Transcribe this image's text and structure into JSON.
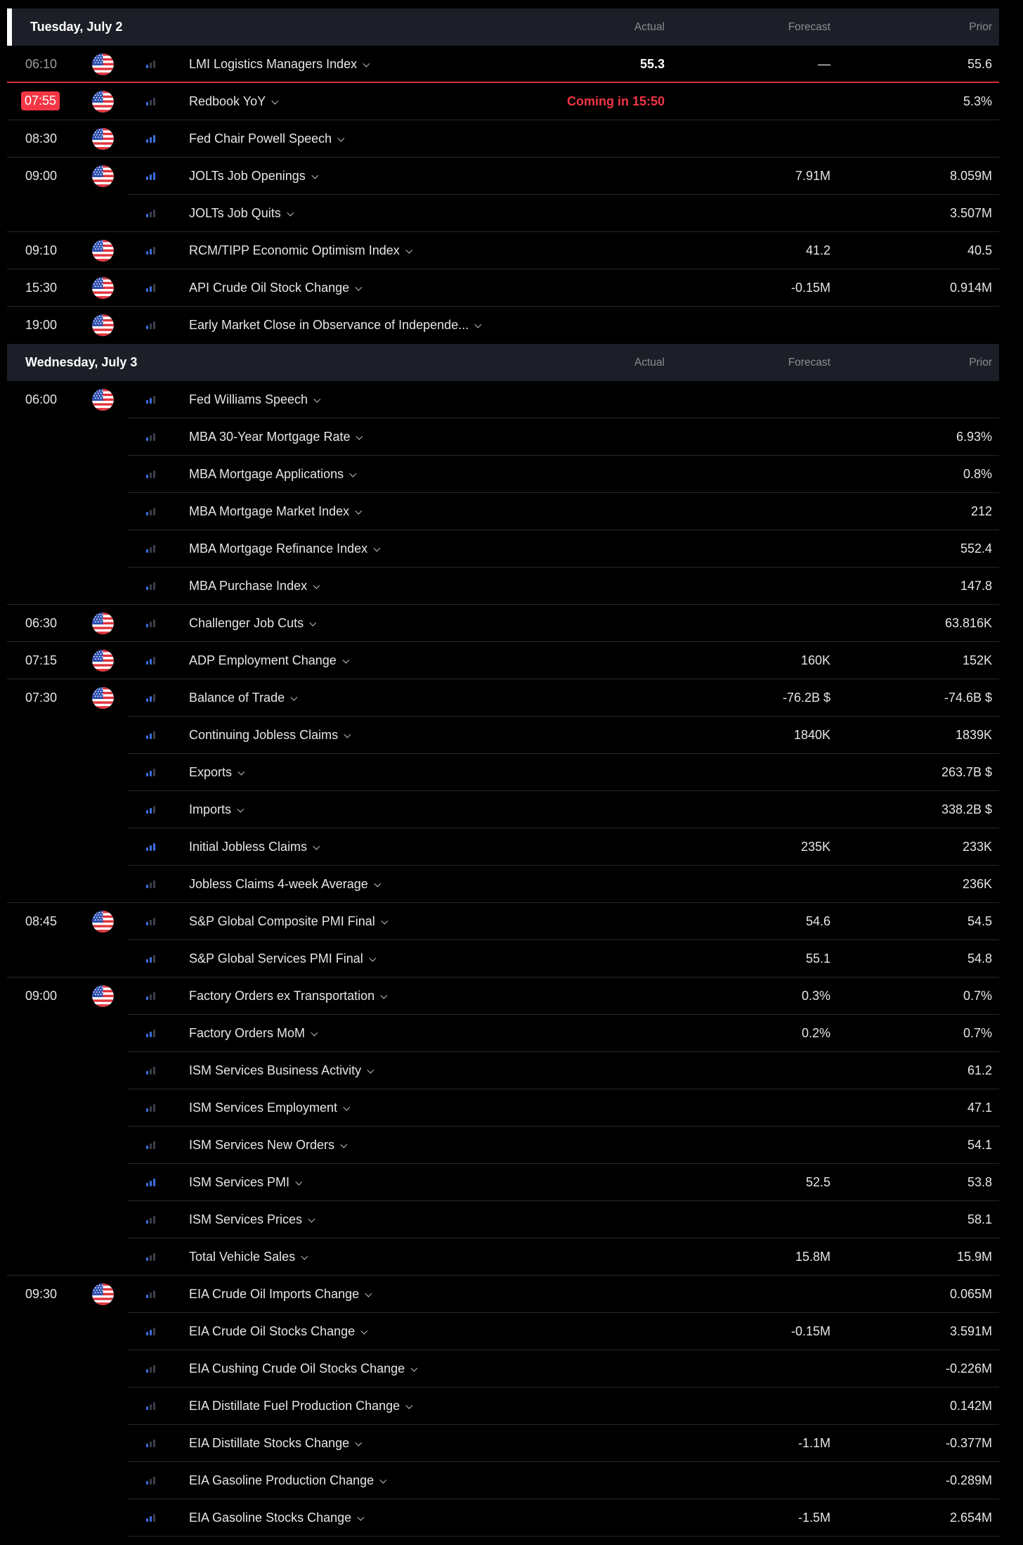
{
  "columns": {
    "actual": "Actual",
    "forecast": "Forecast",
    "prior": "Prior"
  },
  "colors": {
    "background": "#000000",
    "header_bg": "#1c1f27",
    "highlight": "#f23645",
    "bar_on": "#3b6fe0"
  },
  "days": [
    {
      "title": "Tuesday, July 2",
      "events": [
        {
          "time": "06:10",
          "time_style": "dim",
          "flag": true,
          "importance": 1,
          "name": "LMI Logistics Managers Index",
          "actual": "55.3",
          "forecast": "—",
          "prior": "55.6",
          "sep": "red"
        },
        {
          "time": "07:55",
          "time_style": "badge",
          "flag": true,
          "importance": 1,
          "name": "Redbook YoY",
          "actual": "Coming in 15:50",
          "actual_style": "coming",
          "forecast": "",
          "prior": "5.3%",
          "sep": "full"
        },
        {
          "time": "08:30",
          "flag": true,
          "importance": 3,
          "name": "Fed Chair Powell Speech",
          "actual": "",
          "forecast": "",
          "prior": "",
          "sep": "full"
        },
        {
          "time": "09:00",
          "flag": true,
          "importance": 3,
          "name": "JOLTs Job Openings",
          "actual": "",
          "forecast": "7.91M",
          "prior": "8.059M",
          "sep": "indent"
        },
        {
          "time": "",
          "flag": false,
          "importance": 1,
          "name": "JOLTs Job Quits",
          "actual": "",
          "forecast": "",
          "prior": "3.507M",
          "sep": "full"
        },
        {
          "time": "09:10",
          "flag": true,
          "importance": 2,
          "name": "RCM/TIPP Economic Optimism Index",
          "actual": "",
          "forecast": "41.2",
          "prior": "40.5",
          "sep": "full"
        },
        {
          "time": "15:30",
          "flag": true,
          "importance": 2,
          "name": "API Crude Oil Stock Change",
          "actual": "",
          "forecast": "-0.15M",
          "prior": "0.914M",
          "sep": "full"
        },
        {
          "time": "19:00",
          "flag": true,
          "importance": 1,
          "name": "Early Market Close in Observance of Independe...",
          "actual": "",
          "forecast": "",
          "prior": "",
          "sep": "none"
        }
      ]
    },
    {
      "title": "Wednesday, July 3",
      "events": [
        {
          "time": "06:00",
          "flag": true,
          "importance": 2,
          "name": "Fed Williams Speech",
          "actual": "",
          "forecast": "",
          "prior": "",
          "sep": "indent"
        },
        {
          "time": "",
          "flag": false,
          "importance": 1,
          "name": "MBA 30-Year Mortgage Rate",
          "actual": "",
          "forecast": "",
          "prior": "6.93%",
          "sep": "indent"
        },
        {
          "time": "",
          "flag": false,
          "importance": 1,
          "name": "MBA Mortgage Applications",
          "actual": "",
          "forecast": "",
          "prior": "0.8%",
          "sep": "indent"
        },
        {
          "time": "",
          "flag": false,
          "importance": 1,
          "name": "MBA Mortgage Market Index",
          "actual": "",
          "forecast": "",
          "prior": "212",
          "sep": "indent"
        },
        {
          "time": "",
          "flag": false,
          "importance": 1,
          "name": "MBA Mortgage Refinance Index",
          "actual": "",
          "forecast": "",
          "prior": "552.4",
          "sep": "indent"
        },
        {
          "time": "",
          "flag": false,
          "importance": 1,
          "name": "MBA Purchase Index",
          "actual": "",
          "forecast": "",
          "prior": "147.8",
          "sep": "full"
        },
        {
          "time": "06:30",
          "flag": true,
          "importance": 1,
          "name": "Challenger Job Cuts",
          "actual": "",
          "forecast": "",
          "prior": "63.816K",
          "sep": "full"
        },
        {
          "time": "07:15",
          "flag": true,
          "importance": 2,
          "name": "ADP Employment Change",
          "actual": "",
          "forecast": "160K",
          "prior": "152K",
          "sep": "full"
        },
        {
          "time": "07:30",
          "flag": true,
          "importance": 2,
          "name": "Balance of Trade",
          "actual": "",
          "forecast": "-76.2B $",
          "prior": "-74.6B $",
          "sep": "indent"
        },
        {
          "time": "",
          "flag": false,
          "importance": 2,
          "name": "Continuing Jobless Claims",
          "actual": "",
          "forecast": "1840K",
          "prior": "1839K",
          "sep": "indent"
        },
        {
          "time": "",
          "flag": false,
          "importance": 2,
          "name": "Exports",
          "actual": "",
          "forecast": "",
          "prior": "263.7B $",
          "sep": "indent"
        },
        {
          "time": "",
          "flag": false,
          "importance": 2,
          "name": "Imports",
          "actual": "",
          "forecast": "",
          "prior": "338.2B $",
          "sep": "indent"
        },
        {
          "time": "",
          "flag": false,
          "importance": 3,
          "name": "Initial Jobless Claims",
          "actual": "",
          "forecast": "235K",
          "prior": "233K",
          "sep": "indent"
        },
        {
          "time": "",
          "flag": false,
          "importance": 1,
          "name": "Jobless Claims 4-week Average",
          "actual": "",
          "forecast": "",
          "prior": "236K",
          "sep": "full"
        },
        {
          "time": "08:45",
          "flag": true,
          "importance": 1,
          "name": "S&P Global Composite PMI Final",
          "actual": "",
          "forecast": "54.6",
          "prior": "54.5",
          "sep": "indent"
        },
        {
          "time": "",
          "flag": false,
          "importance": 2,
          "name": "S&P Global Services PMI Final",
          "actual": "",
          "forecast": "55.1",
          "prior": "54.8",
          "sep": "full"
        },
        {
          "time": "09:00",
          "flag": true,
          "importance": 1,
          "name": "Factory Orders ex Transportation",
          "actual": "",
          "forecast": "0.3%",
          "prior": "0.7%",
          "sep": "indent"
        },
        {
          "time": "",
          "flag": false,
          "importance": 2,
          "name": "Factory Orders MoM",
          "actual": "",
          "forecast": "0.2%",
          "prior": "0.7%",
          "sep": "indent"
        },
        {
          "time": "",
          "flag": false,
          "importance": 1,
          "name": "ISM Services Business Activity",
          "actual": "",
          "forecast": "",
          "prior": "61.2",
          "sep": "indent"
        },
        {
          "time": "",
          "flag": false,
          "importance": 1,
          "name": "ISM Services Employment",
          "actual": "",
          "forecast": "",
          "prior": "47.1",
          "sep": "indent"
        },
        {
          "time": "",
          "flag": false,
          "importance": 1,
          "name": "ISM Services New Orders",
          "actual": "",
          "forecast": "",
          "prior": "54.1",
          "sep": "indent"
        },
        {
          "time": "",
          "flag": false,
          "importance": 3,
          "name": "ISM Services PMI",
          "actual": "",
          "forecast": "52.5",
          "prior": "53.8",
          "sep": "indent"
        },
        {
          "time": "",
          "flag": false,
          "importance": 1,
          "name": "ISM Services Prices",
          "actual": "",
          "forecast": "",
          "prior": "58.1",
          "sep": "indent"
        },
        {
          "time": "",
          "flag": false,
          "importance": 1,
          "name": "Total Vehicle Sales",
          "actual": "",
          "forecast": "15.8M",
          "prior": "15.9M",
          "sep": "full"
        },
        {
          "time": "09:30",
          "flag": true,
          "importance": 1,
          "name": "EIA Crude Oil Imports Change",
          "actual": "",
          "forecast": "",
          "prior": "0.065M",
          "sep": "indent"
        },
        {
          "time": "",
          "flag": false,
          "importance": 2,
          "name": "EIA Crude Oil Stocks Change",
          "actual": "",
          "forecast": "-0.15M",
          "prior": "3.591M",
          "sep": "indent"
        },
        {
          "time": "",
          "flag": false,
          "importance": 1,
          "name": "EIA Cushing Crude Oil Stocks Change",
          "actual": "",
          "forecast": "",
          "prior": "-0.226M",
          "sep": "indent"
        },
        {
          "time": "",
          "flag": false,
          "importance": 1,
          "name": "EIA Distillate Fuel Production Change",
          "actual": "",
          "forecast": "",
          "prior": "0.142M",
          "sep": "indent"
        },
        {
          "time": "",
          "flag": false,
          "importance": 1,
          "name": "EIA Distillate Stocks Change",
          "actual": "",
          "forecast": "-1.1M",
          "prior": "-0.377M",
          "sep": "indent"
        },
        {
          "time": "",
          "flag": false,
          "importance": 1,
          "name": "EIA Gasoline Production Change",
          "actual": "",
          "forecast": "",
          "prior": "-0.289M",
          "sep": "indent"
        },
        {
          "time": "",
          "flag": false,
          "importance": 2,
          "name": "EIA Gasoline Stocks Change",
          "actual": "",
          "forecast": "-1.5M",
          "prior": "2.654M",
          "sep": "indent"
        }
      ]
    }
  ]
}
